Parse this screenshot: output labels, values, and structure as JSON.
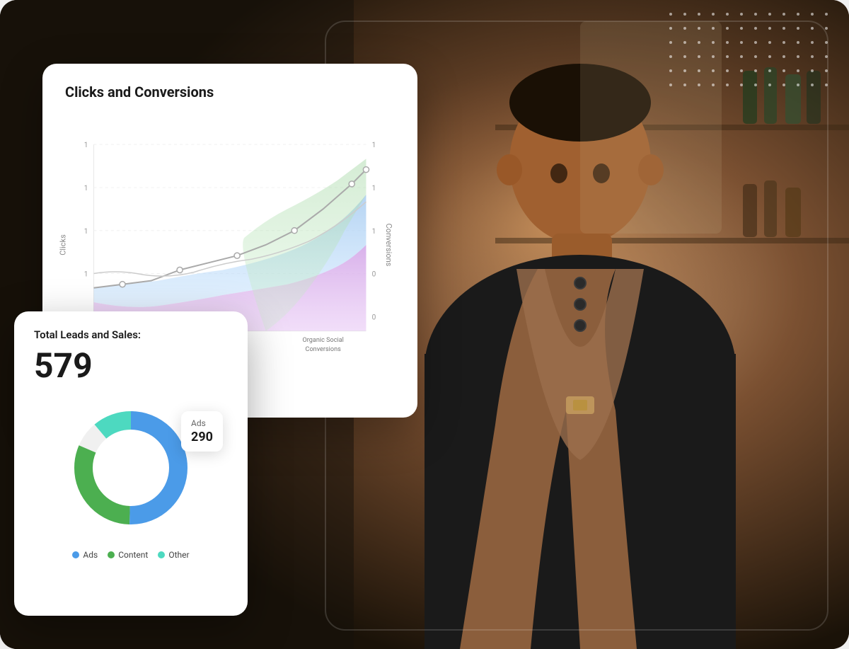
{
  "background": {
    "description": "Background photo of man in apron in a shop"
  },
  "clicks_card": {
    "title": "Clicks and Conversions",
    "y_label_left": "Clicks",
    "y_label_right": "Conversions",
    "y_ticks_left": [
      "1",
      "1",
      "1",
      "1"
    ],
    "y_ticks_right": [
      "1",
      "1",
      "1",
      "0",
      "0"
    ],
    "organic_label": "Organic Social\nConversions"
  },
  "leads_card": {
    "title": "Total Leads and Sales:",
    "total": "579",
    "donut": {
      "segments": [
        {
          "label": "Ads",
          "value": 290,
          "percentage": 50,
          "color": "#4B9BE8"
        },
        {
          "label": "Content",
          "value": 180,
          "percentage": 31,
          "color": "#4CAF50"
        },
        {
          "label": "Other",
          "value": 109,
          "percentage": 19,
          "color": "#4DD9C0"
        }
      ],
      "tooltip": {
        "label": "Ads",
        "value": "290"
      }
    },
    "legend": [
      {
        "label": "Ads",
        "color": "#4B9BE8"
      },
      {
        "label": "Content",
        "color": "#4CAF50"
      },
      {
        "label": "Other",
        "color": "#4DD9C0"
      }
    ]
  },
  "dots": {
    "count": 72
  }
}
